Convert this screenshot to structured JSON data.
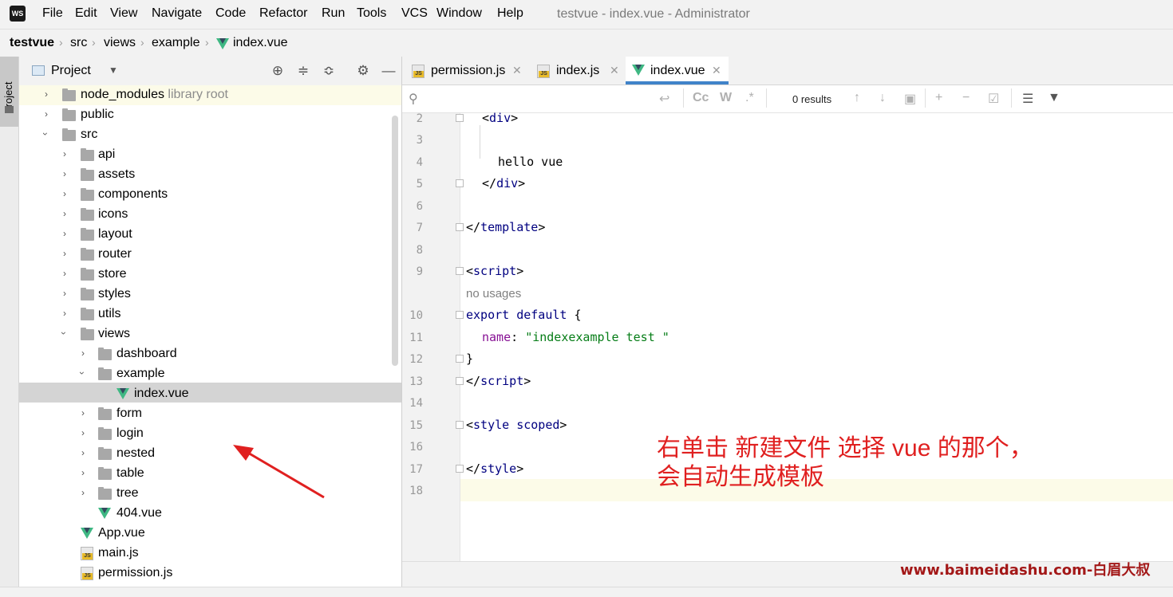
{
  "window": {
    "title": "testvue - index.vue - Administrator"
  },
  "menu": [
    "File",
    "Edit",
    "View",
    "Navigate",
    "Code",
    "Refactor",
    "Run",
    "Tools",
    "VCS",
    "Window",
    "Help"
  ],
  "breadcrumb": [
    "testvue",
    "src",
    "views",
    "example",
    "index.vue"
  ],
  "toolstrip": {
    "project_label": "Project"
  },
  "project": {
    "title": "Project",
    "tree": [
      {
        "label": "node_modules",
        "extra": "library root"
      },
      {
        "label": "public"
      },
      {
        "label": "src"
      },
      {
        "label": "api"
      },
      {
        "label": "assets"
      },
      {
        "label": "components"
      },
      {
        "label": "icons"
      },
      {
        "label": "layout"
      },
      {
        "label": "router"
      },
      {
        "label": "store"
      },
      {
        "label": "styles"
      },
      {
        "label": "utils"
      },
      {
        "label": "views"
      },
      {
        "label": "dashboard"
      },
      {
        "label": "example"
      },
      {
        "label": "index.vue"
      },
      {
        "label": "form"
      },
      {
        "label": "login"
      },
      {
        "label": "nested"
      },
      {
        "label": "table"
      },
      {
        "label": "tree"
      },
      {
        "label": "404.vue"
      },
      {
        "label": "App.vue"
      },
      {
        "label": "main.js"
      },
      {
        "label": "permission.js"
      }
    ]
  },
  "tabs": [
    {
      "label": "permission.js",
      "icon": "js-file-icon"
    },
    {
      "label": "index.js",
      "icon": "js-file-icon"
    },
    {
      "label": "index.vue",
      "icon": "vue-file-icon",
      "active": true
    }
  ],
  "search": {
    "results": "0 results"
  },
  "code": {
    "line_numbers": [
      "2",
      "3",
      "4",
      "5",
      "6",
      "7",
      "8",
      "9",
      "10",
      "11",
      "12",
      "13",
      "14",
      "15",
      "16",
      "17",
      "18"
    ],
    "lines": {
      "l2_open": "<",
      "l2_tag": "div",
      "l2_close": ">",
      "l4_text": "hello vue",
      "l5_open": "</",
      "l5_tag": "div",
      "l5_close": ">",
      "l7_open": "</",
      "l7_tag": "template",
      "l7_close": ">",
      "l9_open": "<",
      "l9_tag": "script",
      "l9_close": ">",
      "usage_hint": "no usages",
      "l10_kw": "export default",
      "l10_rest": " {",
      "l11_attr": "name",
      "l11_colon": ": ",
      "l11_str": "\"indexexample test \"",
      "l12_text": "}",
      "l13_open": "</",
      "l13_tag": "script",
      "l13_close": ">",
      "l15_open": "<",
      "l15_tag": "style",
      "l15_attr": "scoped",
      "l15_close": ">",
      "l17_open": "</",
      "l17_tag": "style",
      "l17_close": ">"
    }
  },
  "annotation": {
    "note": "右单击 新建文件 选择 vue 的那个，\n会自动生成模板"
  },
  "watermark": "www.baimeidashu.com-白眉大叔",
  "colors": {
    "accent": "#4083c9",
    "note_red": "#e02020",
    "vue_green": "#3fb883"
  }
}
